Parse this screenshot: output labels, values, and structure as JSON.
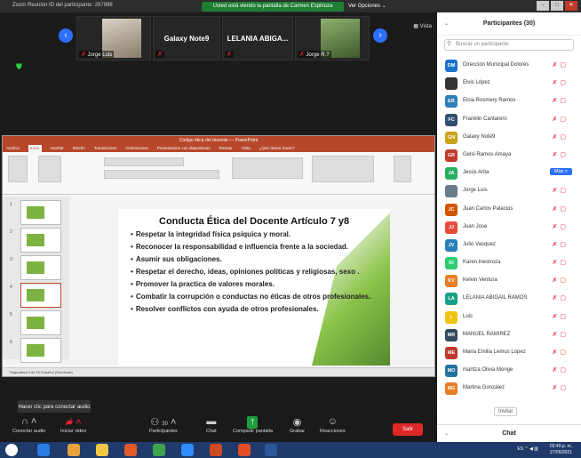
{
  "window": {
    "title": "Zoom Reunión ID del participante: 297988",
    "banner": "Usted está viendo la pantalla de Carmen Espinoza",
    "view_options": "Ver Opciones ⌄"
  },
  "thumbs": [
    {
      "name": "",
      "caption": "Jorge Luis"
    },
    {
      "name": "Galaxy Note9",
      "caption": ""
    },
    {
      "name": "LELANIA ABIGA...",
      "caption": ""
    },
    {
      "name": "",
      "caption": "Jorge R.?"
    }
  ],
  "vista_label": "Vista",
  "ppt": {
    "title": "Código ética del docente — PowerPoint",
    "tabs": [
      "Archivo",
      "Inicio",
      "Insertar",
      "Diseño",
      "Transiciones",
      "Animaciones",
      "Presentación con diapositivas",
      "Revisar",
      "Vista",
      "¿Qué desea hacer?"
    ],
    "slide_title": "Conducta Ética del Docente Artículo 7 y8",
    "bullets": [
      "Respetar la integridad física psíquica y moral.",
      "Reconocer la responsabilidad e influencia  frente a la sociedad.",
      "Asumir sus obligaciones.",
      "Respetar el derecho, ideas, opiniones políticas y religiosas, sexo .",
      "Promover la practica de valores morales.",
      "Combatir la corrupción o conductas no éticas de otros profesionales.",
      "Resolver conflictos con ayuda de otros profesionales."
    ],
    "slide_numbers": [
      "1",
      "2",
      "3",
      "4",
      "5",
      "6"
    ],
    "status": "Diapositiva 4 de 10    Español (Honduras)"
  },
  "tooltip": "Hacer clic para conectar audio",
  "toolbar": {
    "audio": "Conectar audio",
    "video": "Iniciar video",
    "participants": "Participantes",
    "participants_count": "30",
    "chat": "Chat",
    "share": "Compartir pantalla",
    "record": "Grabar",
    "reactions": "Reacciones",
    "leave": "Salir"
  },
  "panel": {
    "title": "Participantes (30)",
    "search_placeholder": "Buscar un participante",
    "more": "Más >",
    "invite": "Invitar",
    "chat_title": "Chat",
    "participants": [
      {
        "initials": "DM",
        "name": "Direccion Municipal Dolores",
        "color": "#1a73c9"
      },
      {
        "initials": "",
        "name": "Elvis López",
        "color": "#333333"
      },
      {
        "initials": "ER",
        "name": "Elcia Rosmery Ramos",
        "color": "#2d7fb8"
      },
      {
        "initials": "FC",
        "name": "Franklin Cantarero",
        "color": "#2f4f6f"
      },
      {
        "initials": "GN",
        "name": "Galaxy Note9",
        "color": "#c9a21a"
      },
      {
        "initials": "GR",
        "name": "Gelsi Ramos Amaya",
        "color": "#c0392b"
      },
      {
        "initials": "JA",
        "name": "Jesús Arita",
        "color": "#27ae60"
      },
      {
        "initials": "",
        "name": "Jorge Luis",
        "color": "#6b7b8c"
      },
      {
        "initials": "JC",
        "name": "Juan Carlos Palacios",
        "color": "#d35400"
      },
      {
        "initials": "JJ",
        "name": "Juan Jose",
        "color": "#e74c3c"
      },
      {
        "initials": "JV",
        "name": "Julio Vasquez",
        "color": "#2980b9"
      },
      {
        "initials": "KI",
        "name": "Karen Inestroza",
        "color": "#2ecc71"
      },
      {
        "initials": "KV",
        "name": "Kelvin Ventura",
        "color": "#e67e22"
      },
      {
        "initials": "LA",
        "name": "LELANIA ABIGAIL RAMOS",
        "color": "#16a085"
      },
      {
        "initials": "L",
        "name": "Luis",
        "color": "#f1c40f"
      },
      {
        "initials": "MR",
        "name": "MANUEL RAMIREZ",
        "color": "#34495e"
      },
      {
        "initials": "ME",
        "name": "Maria Emilia Lemus Lopez",
        "color": "#c0392b"
      },
      {
        "initials": "MO",
        "name": "maritza Olivia Monge",
        "color": "#2471a3"
      },
      {
        "initials": "MG",
        "name": "Martina González",
        "color": "#e67e22"
      }
    ]
  },
  "taskbar": {
    "time": "02:40 p. m.",
    "date": "27/05/2021",
    "lang": "ES"
  }
}
